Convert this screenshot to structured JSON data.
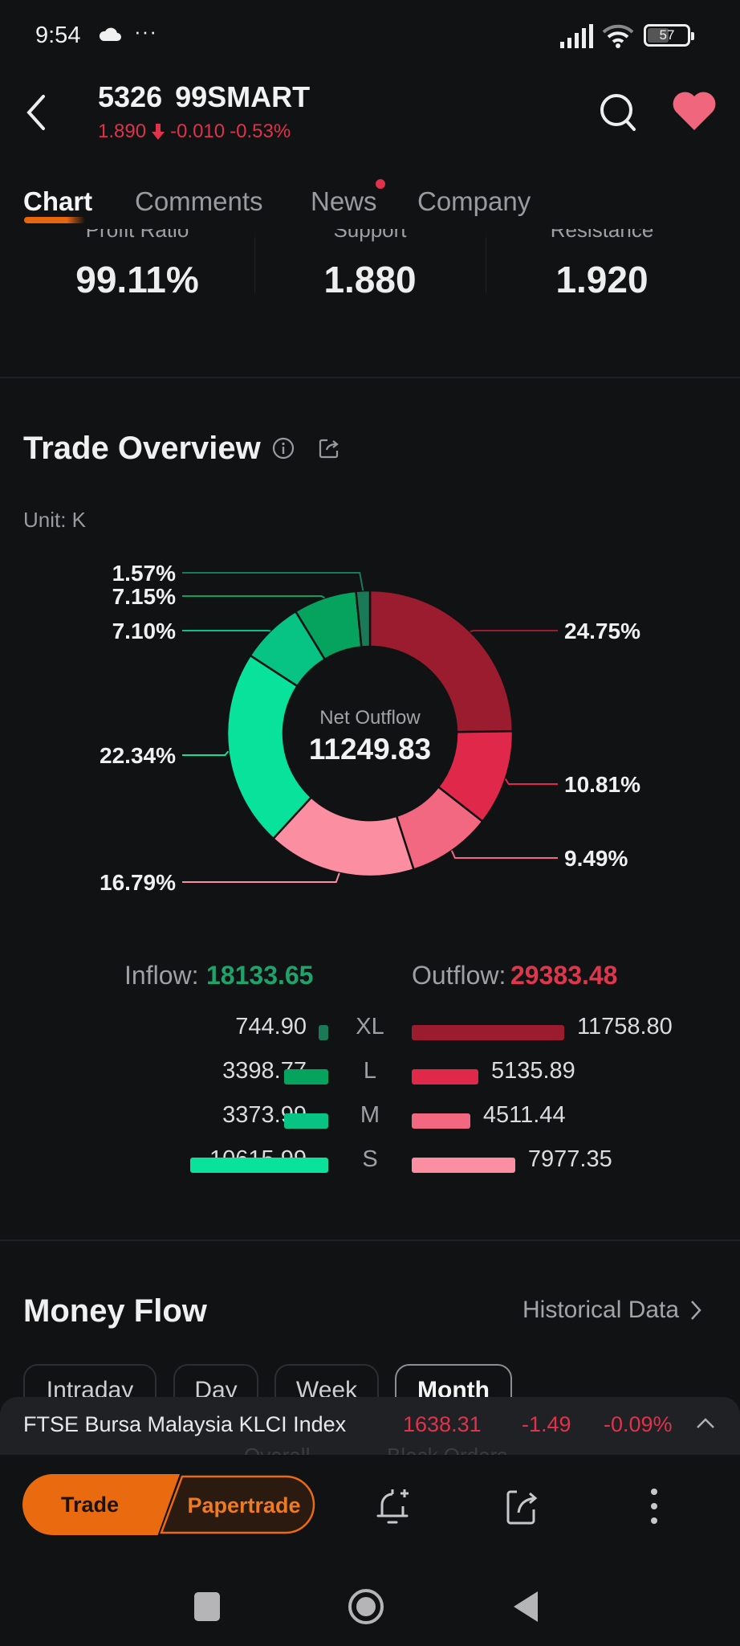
{
  "status_bar": {
    "time": "9:54",
    "dots": "···",
    "battery": "57",
    "icons": [
      "cloud-icon",
      "signal-icon",
      "wifi-icon",
      "battery-icon"
    ]
  },
  "header": {
    "code": "5326",
    "name": "99SMART",
    "title": "5326  99SMART",
    "price": "1.890",
    "change": "-0.010",
    "change_pct": "-0.53%",
    "direction_icon": "arrow-down-icon",
    "down_color": "#e0324a"
  },
  "tabs": [
    {
      "label": "Chart",
      "active": true
    },
    {
      "label": "Comments",
      "active": false
    },
    {
      "label": "News",
      "active": false,
      "badge": true
    },
    {
      "label": "Company",
      "active": false
    }
  ],
  "stats": [
    {
      "label": "Profit Ratio",
      "value": "99.11%"
    },
    {
      "label": "Support",
      "value": "1.880"
    },
    {
      "label": "Resistance",
      "value": "1.920"
    }
  ],
  "trade_overview": {
    "title": "Trade Overview",
    "unit": "Unit: K",
    "center_label": "Net Outflow",
    "center_value": "11249.83",
    "inflow_label": "Inflow:",
    "inflow_value": "18133.65",
    "outflow_label": "Outflow:",
    "outflow_value": "29383.48",
    "colors": {
      "inflow_text": "#1fa36b",
      "outflow_text": "#e0364c"
    },
    "rows": [
      {
        "size": "XL",
        "inflow": "744.90",
        "outflow": "11758.80",
        "in_color": "#1a7a57",
        "out_color": "#9b1c2e"
      },
      {
        "size": "L",
        "inflow": "3398.77",
        "outflow": "5135.89",
        "in_color": "#05a35e",
        "out_color": "#e0294a"
      },
      {
        "size": "M",
        "inflow": "3373.99",
        "outflow": "4511.44",
        "in_color": "#08c484",
        "out_color": "#f26880"
      },
      {
        "size": "S",
        "inflow": "10615.99",
        "outflow": "7977.35",
        "in_color": "#08e29a",
        "out_color": "#fb8ea1"
      }
    ]
  },
  "chart_data": {
    "type": "pie",
    "title": "Trade Overview",
    "subtitle": "Unit: K",
    "donut": true,
    "center_label": "Net Outflow",
    "center_value": 11249.83,
    "slices": [
      {
        "name": "Outflow XL",
        "value": 11758.8,
        "pct": "24.75%",
        "color": "#9b1c2e"
      },
      {
        "name": "Outflow L",
        "value": 5135.89,
        "pct": "10.81%",
        "color": "#e0294a"
      },
      {
        "name": "Outflow M",
        "value": 4511.44,
        "pct": "9.49%",
        "color": "#f26880"
      },
      {
        "name": "Outflow S",
        "value": 7977.35,
        "pct": "16.79%",
        "color": "#fb8ea1"
      },
      {
        "name": "Inflow S",
        "value": 10615.99,
        "pct": "22.34%",
        "color": "#08e29a"
      },
      {
        "name": "Inflow M",
        "value": 3373.99,
        "pct": "7.10%",
        "color": "#08c484"
      },
      {
        "name": "Inflow L",
        "value": 3398.77,
        "pct": "7.15%",
        "color": "#05a35e"
      },
      {
        "name": "Inflow XL",
        "value": 744.9,
        "pct": "1.57%",
        "color": "#1a7a57"
      }
    ]
  },
  "money_flow": {
    "title": "Money Flow",
    "historical_link": "Historical Data",
    "periods": [
      {
        "label": "Intraday",
        "active": false
      },
      {
        "label": "Day",
        "active": false
      },
      {
        "label": "Week",
        "active": false
      },
      {
        "label": "Month",
        "active": true
      }
    ],
    "sub_tabs": [
      "Overall",
      "Block Orders"
    ]
  },
  "index_bar": {
    "name": "FTSE Bursa Malaysia KLCI Index",
    "price": "1638.31",
    "change": "-1.49",
    "change_pct": "-0.09%"
  },
  "action_bar": {
    "trade_label": "Trade",
    "papertrade_label": "Papertrade",
    "accent": "#ea6a10"
  }
}
